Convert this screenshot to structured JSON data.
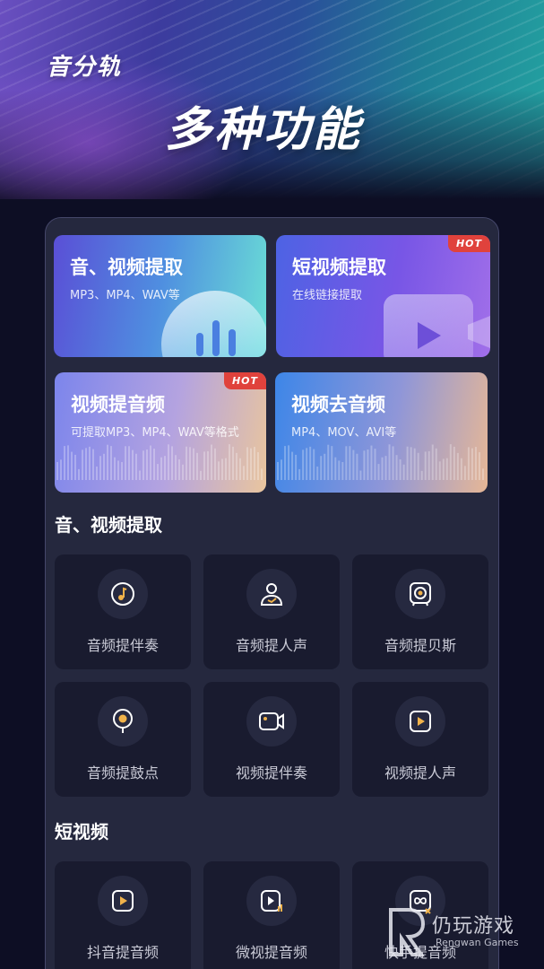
{
  "banner": {
    "app_name": "音分轨",
    "headline": "多种功能"
  },
  "feature_cards": [
    {
      "title": "音、视频提取",
      "subtitle": "MP3、MP4、WAV等",
      "badge": ""
    },
    {
      "title": "短视频提取",
      "subtitle": "在线链接提取",
      "badge": "HOT"
    },
    {
      "title": "视频提音频",
      "subtitle": "可提取MP3、MP4、WAV等格式",
      "badge": "HOT"
    },
    {
      "title": "视频去音频",
      "subtitle": "MP4、MOV、AVI等",
      "badge": ""
    }
  ],
  "sections": [
    {
      "title": "音、视频提取",
      "items": [
        {
          "label": "音频提伴奏",
          "icon": "music-note-icon"
        },
        {
          "label": "音频提人声",
          "icon": "person-voice-icon"
        },
        {
          "label": "音频提贝斯",
          "icon": "speaker-icon"
        },
        {
          "label": "音频提鼓点",
          "icon": "location-pin-icon"
        },
        {
          "label": "视频提伴奏",
          "icon": "video-camera-icon"
        },
        {
          "label": "视频提人声",
          "icon": "play-square-icon"
        }
      ]
    },
    {
      "title": "短视频",
      "items": [
        {
          "label": "抖音提音频",
          "icon": "play-square-icon"
        },
        {
          "label": "微视提音频",
          "icon": "play-square-wave-icon"
        },
        {
          "label": "快手提音频",
          "icon": "kuaishou-icon"
        }
      ]
    }
  ],
  "watermark": {
    "text": "仍玩游戏",
    "sub": "Rengwan Games"
  },
  "colors": {
    "background": "#0d0e24",
    "panel": "#25283e",
    "tile": "#191b2f",
    "hot_badge": "#e0423c",
    "icon_accent": "#f0b24a"
  }
}
